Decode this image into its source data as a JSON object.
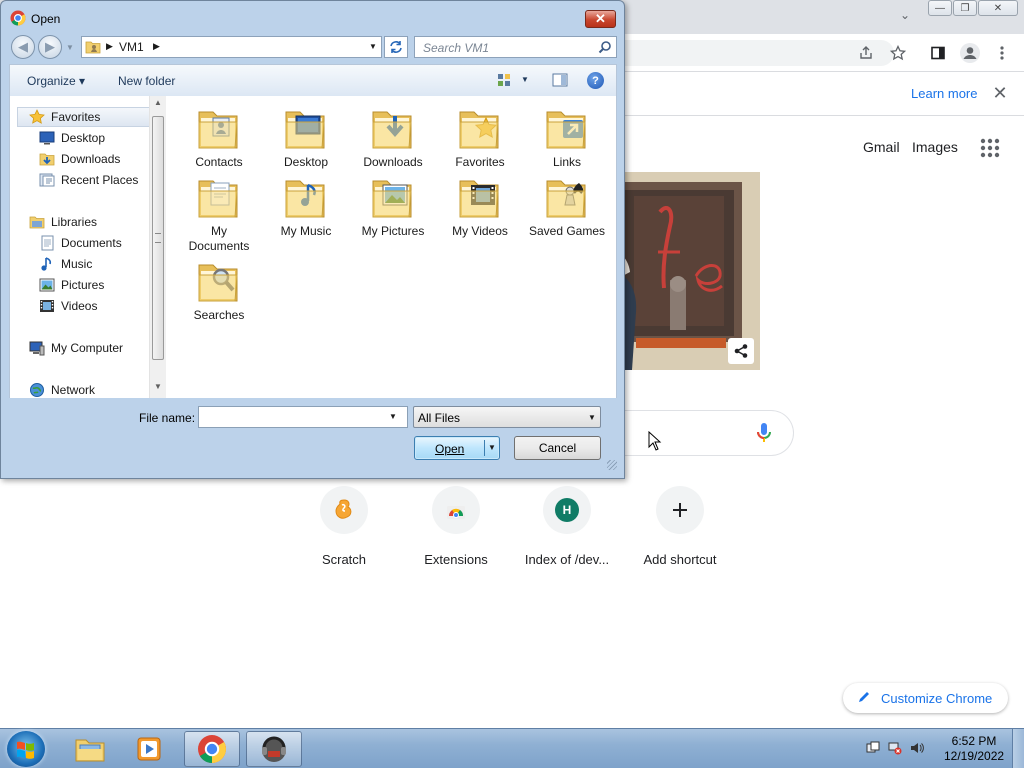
{
  "chrome": {
    "window_controls": [
      "minimize",
      "restore",
      "close"
    ],
    "infobar": {
      "learn_more": "Learn more"
    },
    "header_links": {
      "gmail": "Gmail",
      "images": "Images"
    },
    "shortcuts": [
      {
        "label": "Scratch",
        "icon": "scratch-icon"
      },
      {
        "label": "Extensions",
        "icon": "chrome-web-store-icon"
      },
      {
        "label": "Index of /dev...",
        "icon": "letter-avatar",
        "letter": "H"
      },
      {
        "label": "Add shortcut",
        "icon": "plus-icon"
      }
    ],
    "customize": "Customize Chrome"
  },
  "dialog": {
    "title": "Open",
    "close_glyph": "✕",
    "address": {
      "location": "VM1"
    },
    "search": {
      "placeholder": "Search VM1"
    },
    "toolbar": {
      "organize": "Organize",
      "new_folder": "New folder",
      "help": "?"
    },
    "nav": {
      "favorites": "Favorites",
      "favorites_items": [
        "Desktop",
        "Downloads",
        "Recent Places"
      ],
      "libraries": "Libraries",
      "libraries_items": [
        "Documents",
        "Music",
        "Pictures",
        "Videos"
      ],
      "computer": "My Computer",
      "network": "Network"
    },
    "folders": [
      {
        "label": "Contacts",
        "overlay": "contacts"
      },
      {
        "label": "Desktop",
        "overlay": "desktop"
      },
      {
        "label": "Downloads",
        "overlay": "downloads"
      },
      {
        "label": "Favorites",
        "overlay": "favorites"
      },
      {
        "label": "Links",
        "overlay": "links"
      },
      {
        "label": "My Documents",
        "overlay": "documents"
      },
      {
        "label": "My Music",
        "overlay": "music"
      },
      {
        "label": "My Pictures",
        "overlay": "pictures"
      },
      {
        "label": "My Videos",
        "overlay": "videos"
      },
      {
        "label": "Saved Games",
        "overlay": "games"
      },
      {
        "label": "Searches",
        "overlay": "searches"
      }
    ],
    "file_name": {
      "label": "File name:",
      "value": ""
    },
    "filter": {
      "selected": "All Files"
    },
    "buttons": {
      "open": "Open",
      "cancel": "Cancel"
    }
  },
  "taskbar": {
    "pinned": [
      "explorer",
      "media-player",
      "chrome",
      "app"
    ],
    "clock": {
      "time": "6:52 PM",
      "date": "12/19/2022"
    }
  },
  "colors": {
    "accent": "#1a73e8",
    "dialog_frame": "#bcd2ea",
    "folder": "#f5d97a"
  }
}
